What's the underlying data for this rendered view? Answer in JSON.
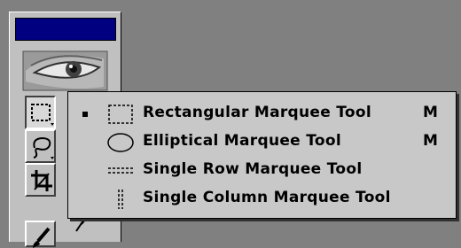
{
  "toolbox": {
    "title_bar_color": "#000080",
    "logo": "eye-logo",
    "tools": [
      {
        "name": "marquee",
        "icon": "rectangular-marquee-icon",
        "pressed": true
      },
      {
        "name": "lasso",
        "icon": "lasso-icon",
        "pressed": false
      },
      {
        "name": "crop",
        "icon": "crop-icon",
        "pressed": false
      },
      {
        "name": "brush",
        "icon": "paintbrush-icon",
        "pressed": false
      }
    ]
  },
  "flyout_menu": {
    "items": [
      {
        "label": "Rectangular Marquee Tool",
        "shortcut": "M",
        "checked": true,
        "icon": "rectangular-marquee-icon"
      },
      {
        "label": "Elliptical Marquee Tool",
        "shortcut": "M",
        "checked": false,
        "icon": "elliptical-marquee-icon"
      },
      {
        "label": "Single Row Marquee Tool",
        "shortcut": "",
        "checked": false,
        "icon": "single-row-marquee-icon"
      },
      {
        "label": "Single Column Marquee Tool",
        "shortcut": "",
        "checked": false,
        "icon": "single-column-marquee-icon"
      }
    ]
  }
}
